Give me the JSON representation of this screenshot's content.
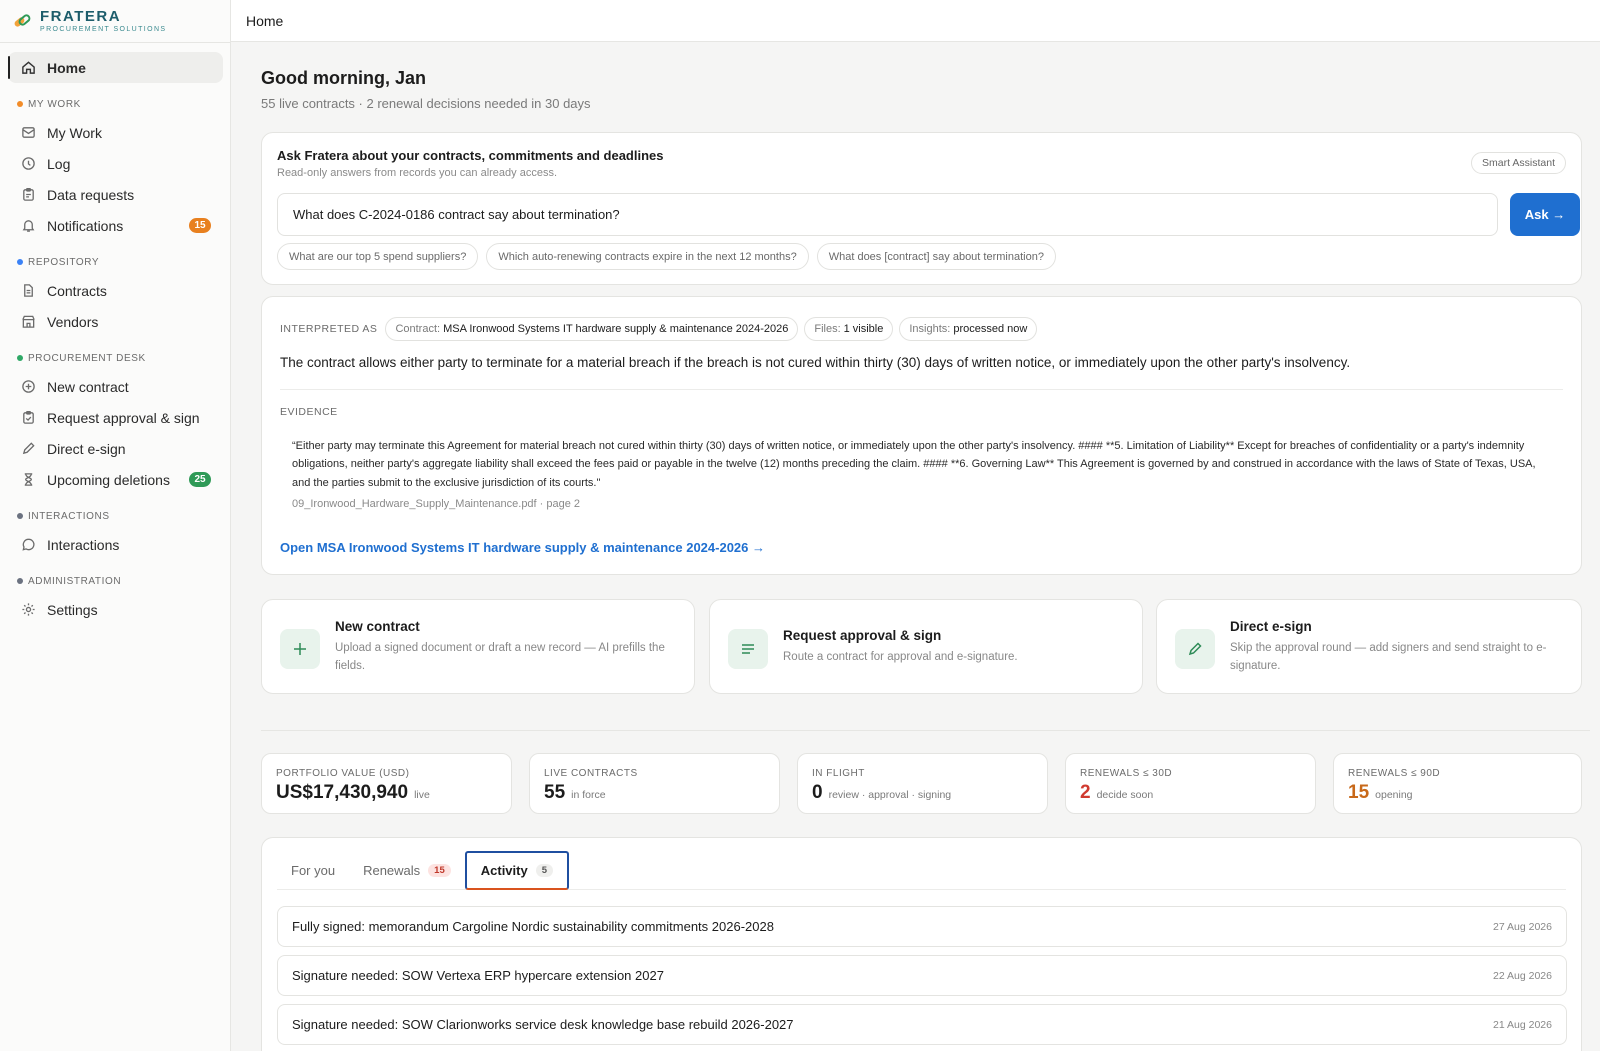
{
  "brand": {
    "name": "FRATERA",
    "sub": "PROCUREMENT SOLUTIONS"
  },
  "sidebar": {
    "home": "Home",
    "sections": [
      {
        "label": "MY WORK",
        "color": "#f28c28",
        "items": [
          {
            "label": "My Work",
            "icon": "inbox-icon"
          },
          {
            "label": "Log",
            "icon": "clock-icon"
          },
          {
            "label": "Data requests",
            "icon": "clipboard-icon"
          },
          {
            "label": "Notifications",
            "icon": "bell-icon",
            "badge": "15",
            "badge_color": "#e8801f"
          }
        ]
      },
      {
        "label": "REPOSITORY",
        "color": "#3b82f6",
        "items": [
          {
            "label": "Contracts",
            "icon": "document-icon"
          },
          {
            "label": "Vendors",
            "icon": "store-icon"
          }
        ]
      },
      {
        "label": "PROCUREMENT DESK",
        "color": "#2fa866",
        "items": [
          {
            "label": "New contract",
            "icon": "plus-circle-icon"
          },
          {
            "label": "Request approval & sign",
            "icon": "clipboard-check-icon"
          },
          {
            "label": "Direct e-sign",
            "icon": "pen-icon"
          },
          {
            "label": "Upcoming deletions",
            "icon": "hourglass-icon",
            "badge": "25",
            "badge_color": "#2f9a57"
          }
        ]
      },
      {
        "label": "INTERACTIONS",
        "color": "#6b7280",
        "items": [
          {
            "label": "Interactions",
            "icon": "chat-icon"
          }
        ]
      },
      {
        "label": "ADMINISTRATION",
        "color": "#6b7280",
        "items": [
          {
            "label": "Settings",
            "icon": "gear-icon"
          }
        ]
      }
    ]
  },
  "topbar": {
    "breadcrumb": "Home"
  },
  "greeting": {
    "title": "Good morning, Jan",
    "subtitle": "55 live contracts · 2 renewal decisions needed in 30 days"
  },
  "ask": {
    "title": "Ask Fratera about your contracts, commitments and deadlines",
    "subtitle": "Read-only answers from records you can already access.",
    "tag": "Smart Assistant",
    "input_value": "What does C-2024-0186 contract say about termination?",
    "button": "Ask →",
    "suggestions": [
      "What are our top 5 spend suppliers?",
      "Which auto-renewing contracts expire in the next 12 months?",
      "What does [contract] say about termination?"
    ]
  },
  "answer": {
    "interpreted_label": "INTERPRETED AS",
    "pills": [
      {
        "key": "Contract:",
        "value": "MSA Ironwood Systems IT hardware supply & maintenance 2024-2026"
      },
      {
        "key": "Files:",
        "value": "1 visible"
      },
      {
        "key": "Insights:",
        "value": "processed now"
      }
    ],
    "text": "The contract allows either party to terminate for a material breach if the breach is not cured within thirty (30) days of written notice, or immediately upon the other party's insolvency.",
    "evidence_label": "EVIDENCE",
    "evidence_quote": "“Either party may terminate this Agreement for material breach not cured within thirty (30) days of written notice, or immediately upon the other party's insolvency. #### **5. Limitation of Liability** Except for breaches of confidentiality or a party's indemnity obligations, neither party's aggregate liability shall exceed the fees paid or payable in the twelve (12) months preceding the claim. #### **6. Governing Law** This Agreement is governed by and construed in accordance with the laws of State of Texas, USA, and the parties submit to the exclusive jurisdiction of its courts.\"",
    "evidence_source": "09_Ironwood_Hardware_Supply_Maintenance.pdf · page 2",
    "open_link": "Open MSA Ironwood Systems IT hardware supply & maintenance 2024-2026 →"
  },
  "actions": [
    {
      "title": "New contract",
      "desc": "Upload a signed document or draft a new record — AI prefills the fields.",
      "icon": "plus-icon"
    },
    {
      "title": "Request approval & sign",
      "desc": "Route a contract for approval and e-signature.",
      "icon": "lines-icon"
    },
    {
      "title": "Direct e-sign",
      "desc": "Skip the approval round — add signers and send straight to e-signature.",
      "icon": "pen-icon"
    }
  ],
  "stats": [
    {
      "label": "PORTFOLIO VALUE (USD)",
      "value": "US$17,430,940",
      "note": "live",
      "color": "#1c1c1c"
    },
    {
      "label": "LIVE CONTRACTS",
      "value": "55",
      "note": "in force",
      "color": "#1c1c1c"
    },
    {
      "label": "IN FLIGHT",
      "value": "0",
      "note": "review · approval · signing",
      "color": "#1c1c1c"
    },
    {
      "label": "RENEWALS ≤ 30D",
      "value": "2",
      "note": "decide soon",
      "color": "#d03a2f"
    },
    {
      "label": "RENEWALS ≤ 90D",
      "value": "15",
      "note": "opening",
      "color": "#c8691a"
    }
  ],
  "tabs": [
    {
      "label": "For you",
      "count": ""
    },
    {
      "label": "Renewals",
      "count": "15"
    },
    {
      "label": "Activity",
      "count": "5"
    }
  ],
  "activity": [
    {
      "title": "Fully signed: memorandum Cargoline Nordic sustainability commitments 2026-2028",
      "date": "27 Aug 2026"
    },
    {
      "title": "Signature needed: SOW Vertexa ERP hypercare extension 2027",
      "date": "22 Aug 2026"
    },
    {
      "title": "Signature needed: SOW Clarionworks service desk knowledge base rebuild 2026-2027",
      "date": "21 Aug 2026"
    }
  ]
}
